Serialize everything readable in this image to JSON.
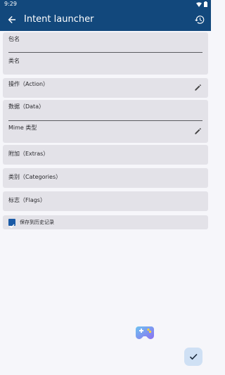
{
  "status_bar": {
    "time": "9:29"
  },
  "app_bar": {
    "title": "Intent launcher"
  },
  "fields": {
    "package_label": "包名",
    "class_label": "类名",
    "action_label": "操作（Action）",
    "data_label": "数据（Data）",
    "mime_label": "Mime 类型",
    "extras_label": "附加（Extras）",
    "categories_label": "类别（Categories）",
    "flags_label": "标志（Flags）"
  },
  "save_history": {
    "label": "保存到历史记录",
    "checked": true
  },
  "icons": {
    "back": "arrow-back-icon",
    "history": "history-icon",
    "edit": "pencil-icon",
    "confirm": "check-icon",
    "floating": "gamepad-icon"
  },
  "colors": {
    "app_bar": "#12487c",
    "background": "#f6f6fa",
    "card": "#e3e2e8",
    "checkbox": "#1a5aa6",
    "fab": "#cfe0f4"
  }
}
